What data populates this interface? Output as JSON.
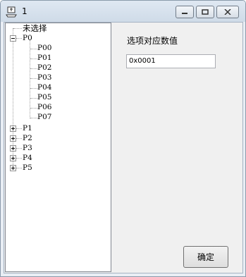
{
  "window": {
    "title": "1",
    "icon": "app-icon"
  },
  "tree": {
    "unselected_label": "未选择",
    "root": {
      "label": "P0",
      "expanded": true,
      "children": [
        "P00",
        "P01",
        "P02",
        "P03",
        "P04",
        "P05",
        "P06",
        "P07"
      ]
    },
    "collapsed": [
      "P1",
      "P2",
      "P3",
      "P4",
      "P5"
    ]
  },
  "panel": {
    "value_label": "选项对应数值",
    "value": "0x0001",
    "ok_label": "确定"
  }
}
